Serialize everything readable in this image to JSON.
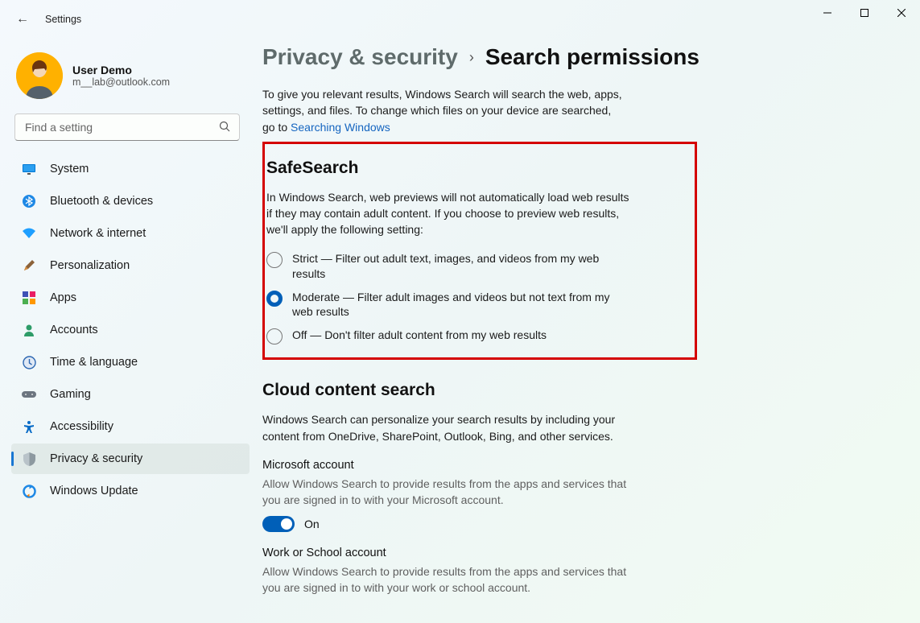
{
  "window": {
    "title": "Settings"
  },
  "user": {
    "name": "User Demo",
    "email": "m__lab@outlook.com"
  },
  "search": {
    "placeholder": "Find a setting"
  },
  "nav": {
    "items": [
      {
        "label": "System"
      },
      {
        "label": "Bluetooth & devices"
      },
      {
        "label": "Network & internet"
      },
      {
        "label": "Personalization"
      },
      {
        "label": "Apps"
      },
      {
        "label": "Accounts"
      },
      {
        "label": "Time & language"
      },
      {
        "label": "Gaming"
      },
      {
        "label": "Accessibility"
      },
      {
        "label": "Privacy & security"
      },
      {
        "label": "Windows Update"
      }
    ]
  },
  "breadcrumb": {
    "parent": "Privacy & security",
    "sep": "›",
    "current": "Search permissions"
  },
  "intro": {
    "text_before": "To give you relevant results, Windows Search will search the web, apps, settings, and files. To change which files on your device are searched, go to ",
    "link": "Searching Windows"
  },
  "safesearch": {
    "title": "SafeSearch",
    "desc": "In Windows Search, web previews will not automatically load web results if they may contain adult content. If you choose to preview web results, we'll apply the following setting:",
    "options": [
      {
        "label": "Strict — Filter out adult text, images, and videos from my web results",
        "checked": false
      },
      {
        "label": "Moderate — Filter adult images and videos but not text from my web results",
        "checked": true
      },
      {
        "label": "Off — Don't filter adult content from my web results",
        "checked": false
      }
    ]
  },
  "cloud": {
    "title": "Cloud content search",
    "desc": "Windows Search can personalize your search results by including your content from OneDrive, SharePoint, Outlook, Bing, and other services.",
    "ms_account": {
      "title": "Microsoft account",
      "desc": "Allow Windows Search to provide results from the apps and services that you are signed in to with your Microsoft account.",
      "toggle_label": "On"
    },
    "work_account": {
      "title": "Work or School account",
      "desc": "Allow Windows Search to provide results from the apps and services that you are signed in to with your work or school account."
    }
  }
}
